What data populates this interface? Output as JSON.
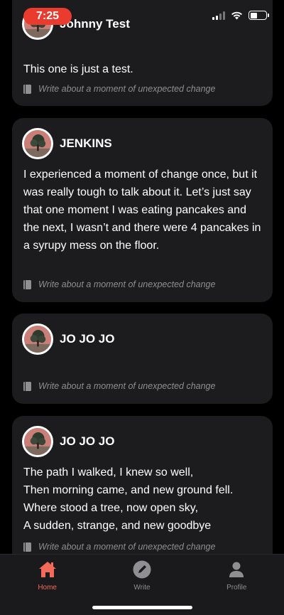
{
  "status_bar": {
    "time": "7:25"
  },
  "posts": [
    {
      "author": "Johnny Test",
      "body": "This one is just a test.",
      "prompt": "Write about a moment of unexpected change"
    },
    {
      "author": "JENKINS",
      "body": "I experienced a moment of change once, but it was really tough to talk about it. Let’s just say that one moment I was eating pancakes and the next, I wasn’t and there were 4 pancakes in a syrupy mess on the floor.",
      "prompt": "Write about a moment of unexpected change"
    },
    {
      "author": "JO JO JO",
      "body": "",
      "prompt": "Write about a moment of unexpected change"
    },
    {
      "author": "JO JO JO",
      "body_lines": [
        "The path I walked, I knew so well,",
        "Then morning came, and new ground fell.",
        "Where stood a tree, now open sky,",
        "A sudden, strange, and new goodbye"
      ],
      "prompt": "Write about a moment of unexpected change"
    }
  ],
  "tab_bar": {
    "tabs": [
      {
        "label": "Home",
        "icon": "home-icon",
        "active": true
      },
      {
        "label": "Write",
        "icon": "pencil-icon",
        "active": false
      },
      {
        "label": "Profile",
        "icon": "person-icon",
        "active": false
      }
    ]
  },
  "colors": {
    "accent": "#f26a5a",
    "card_bg": "#1c1c1e",
    "time_pill": "#ea3c2e",
    "muted": "#8e8e93"
  }
}
